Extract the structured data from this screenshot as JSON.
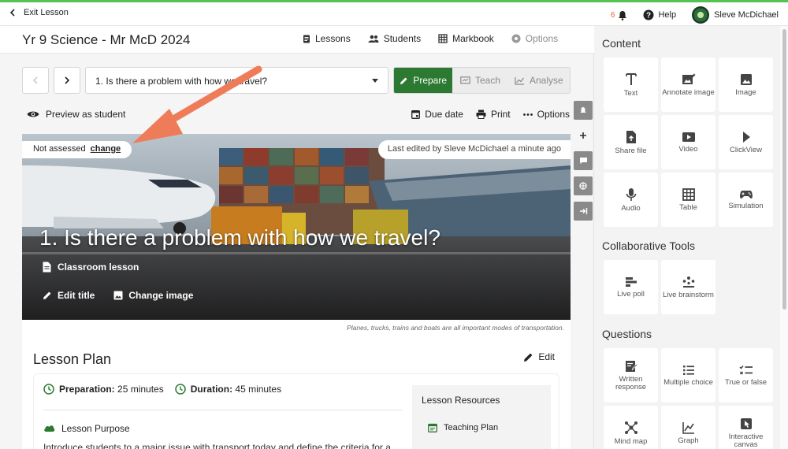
{
  "topbar": {
    "exit_label": "Exit Lesson",
    "notifications_count": "6",
    "help_label": "Help",
    "user_name": "Sleve McDichael"
  },
  "header": {
    "course_title": "Yr 9 Science - Mr McD 2024",
    "nav": [
      {
        "label": "Lessons",
        "icon": "document-icon"
      },
      {
        "label": "Students",
        "icon": "people-icon"
      },
      {
        "label": "Markbook",
        "icon": "grid-icon"
      },
      {
        "label": "Options",
        "icon": "gear-icon"
      }
    ]
  },
  "toolbar": {
    "lesson_selected": "1. Is there a problem with how we travel?",
    "modes": [
      "Prepare",
      "Teach",
      "Analyse"
    ],
    "active_mode": "Prepare",
    "preview_label": "Preview as student",
    "due_date_label": "Due date",
    "print_label": "Print",
    "options_label": "Options"
  },
  "hero": {
    "assessed_label": "Not assessed",
    "change_label": "change",
    "last_edited": "Last edited by Sleve McDichael a minute ago",
    "title": "1. Is there a problem with how we travel?",
    "lesson_type": "Classroom lesson",
    "edit_title_label": "Edit title",
    "change_image_label": "Change image",
    "caption": "Planes, trucks, trains and boats are all important modes of transportation."
  },
  "plan": {
    "title": "Lesson Plan",
    "edit_label": "Edit",
    "preparation_label": "Preparation:",
    "preparation_value": "25 minutes",
    "duration_label": "Duration:",
    "duration_value": "45 minutes",
    "purpose_label": "Lesson Purpose",
    "purpose_text": "Introduce students to a major issue with transport today and define the criteria for a",
    "resources_title": "Lesson Resources",
    "resources": [
      "Teaching Plan"
    ]
  },
  "panel": {
    "content_title": "Content",
    "content_tiles": [
      "Text",
      "Annotate image",
      "Image",
      "Share file",
      "Video",
      "ClickView",
      "Audio",
      "Table",
      "Simulation"
    ],
    "collab_title": "Collaborative Tools",
    "collab_tiles": [
      "Live poll",
      "Live brainstorm"
    ],
    "questions_title": "Questions",
    "question_tiles": [
      "Written response",
      "Multiple choice",
      "True or false",
      "Mind map",
      "Graph",
      "Interactive canvas"
    ]
  },
  "colors": {
    "brand_green": "#2c7a32",
    "topbar_accent": "#54c352",
    "annotation_arrow": "#ef7c58"
  }
}
